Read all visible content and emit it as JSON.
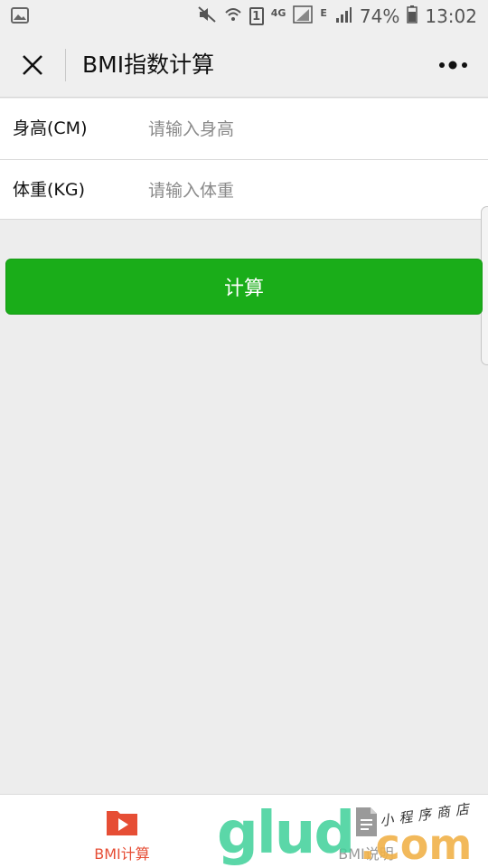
{
  "status_bar": {
    "sim_label": "1",
    "network_4g": "4G",
    "network_e": "E",
    "battery": "74%",
    "time": "13:02"
  },
  "nav": {
    "title": "BMI指数计算"
  },
  "form": {
    "height_label": "身高(CM)",
    "height_placeholder": "请输入身高",
    "height_value": "",
    "weight_label": "体重(KG)",
    "weight_placeholder": "请输入体重",
    "weight_value": ""
  },
  "actions": {
    "calculate_label": "计算"
  },
  "tabbar": {
    "tabs": [
      {
        "label": "BMI计算",
        "icon": "video-folder-icon",
        "active": true
      },
      {
        "label": "BMI说明",
        "icon": "document-icon",
        "active": false
      }
    ]
  },
  "watermark": {
    "brand": "glud",
    "domain": ".com",
    "tagline": "小程序商店"
  },
  "colors": {
    "primary_green": "#1aad19",
    "active_tab": "#e64e35",
    "inactive_tab": "#9a9a9a",
    "background": "#ededed"
  }
}
